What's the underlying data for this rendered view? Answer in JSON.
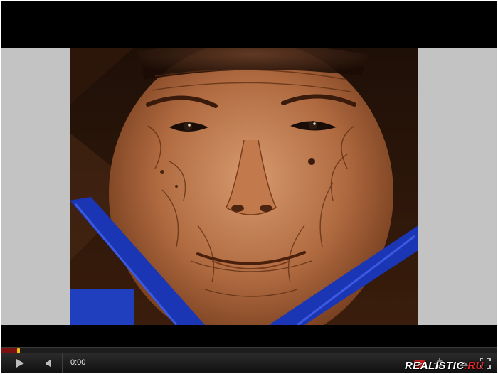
{
  "player": {
    "time": "0:00",
    "progress_fraction": 0.035,
    "watermark_main": "REALISTIC",
    "watermark_accent": ".RU"
  },
  "controls": {
    "play_icon": "play-icon",
    "volume_icon": "speaker-icon",
    "youtube_icon": "youtube-logo-icon",
    "settings_icon": "gear-icon",
    "fullscreen_icon": "fullscreen-icon"
  },
  "colors": {
    "letterbox": "#000000",
    "pillarbox": "#c3c3c3",
    "progress_knob": "#f2c10b",
    "watermark_accent": "#e8262a"
  }
}
